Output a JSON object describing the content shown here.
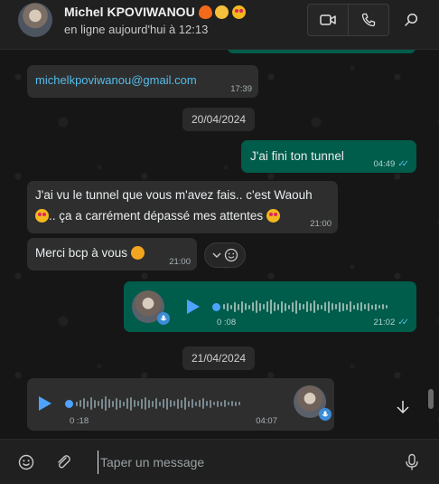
{
  "header": {
    "contact_name": "Michel KPOVIWANOU",
    "status": "en ligne aujourd'hui à 12:13",
    "name_emojis": [
      "fire",
      "mind-blown",
      "heart-eyes"
    ]
  },
  "messages": {
    "email": {
      "text": "michelkpoviwanou@gmail.com",
      "time": "17:39"
    },
    "date1": "20/04/2024",
    "out1": {
      "text": "J'ai fini ton tunnel",
      "time": "04:49"
    },
    "in1": {
      "line1": "J'ai vu le tunnel que vous m'avez fais..  c'est Waouh",
      "line2": ".. ça a carrément dépassé mes attentes",
      "time": "21:00"
    },
    "in2": {
      "text": "Merci bcp à vous",
      "time": "21:00"
    },
    "voice_out": {
      "duration": "0 :08",
      "time": "21:02"
    },
    "date2": "21/04/2024",
    "voice_in": {
      "duration": "0 :18",
      "time": "04:07"
    }
  },
  "composer": {
    "placeholder": "Taper un message"
  },
  "colors": {
    "outgoing": "#005c4b",
    "incoming": "#2e2e2e",
    "link": "#53bdeb",
    "read_ticks": "#53bdeb"
  }
}
